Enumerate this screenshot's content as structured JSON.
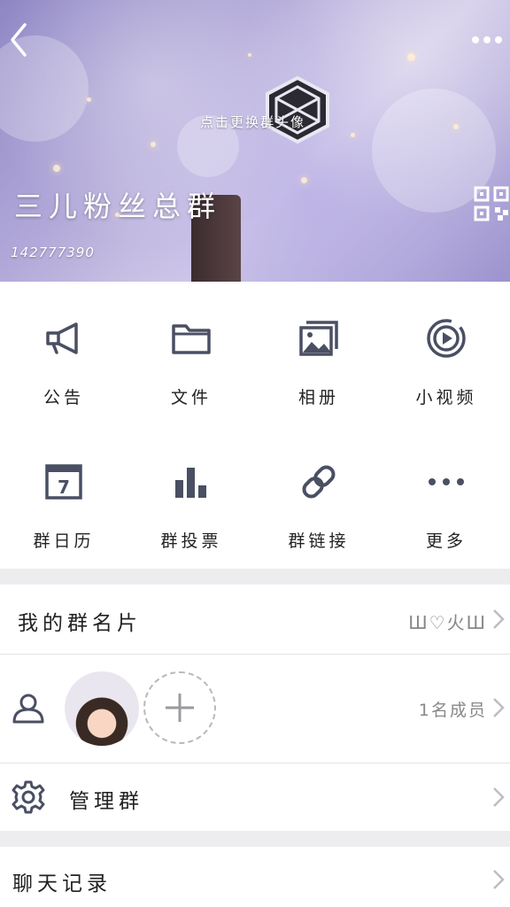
{
  "header": {
    "change_avatar_hint": "点击更换群头像",
    "group_name": "三儿粉丝总群",
    "group_id": "142777390"
  },
  "features": [
    {
      "label": "公告",
      "icon": "megaphone-icon"
    },
    {
      "label": "文件",
      "icon": "folder-icon"
    },
    {
      "label": "相册",
      "icon": "album-icon"
    },
    {
      "label": "小视频",
      "icon": "video-icon"
    },
    {
      "label": "群日历",
      "icon": "calendar-icon",
      "calendar_day": "7"
    },
    {
      "label": "群投票",
      "icon": "bar-chart-icon"
    },
    {
      "label": "群链接",
      "icon": "link-icon"
    },
    {
      "label": "更多",
      "icon": "more-icon"
    }
  ],
  "my_card": {
    "label": "我的群名片",
    "value": "Ш♡火Ш"
  },
  "members": {
    "count_text": "1名成员"
  },
  "manage": {
    "label": "管理群"
  },
  "chat_history": {
    "label": "聊天记录"
  },
  "colors": {
    "icon": "#4a4f63",
    "separator": "#ededf0",
    "secondary_text": "#888888"
  }
}
